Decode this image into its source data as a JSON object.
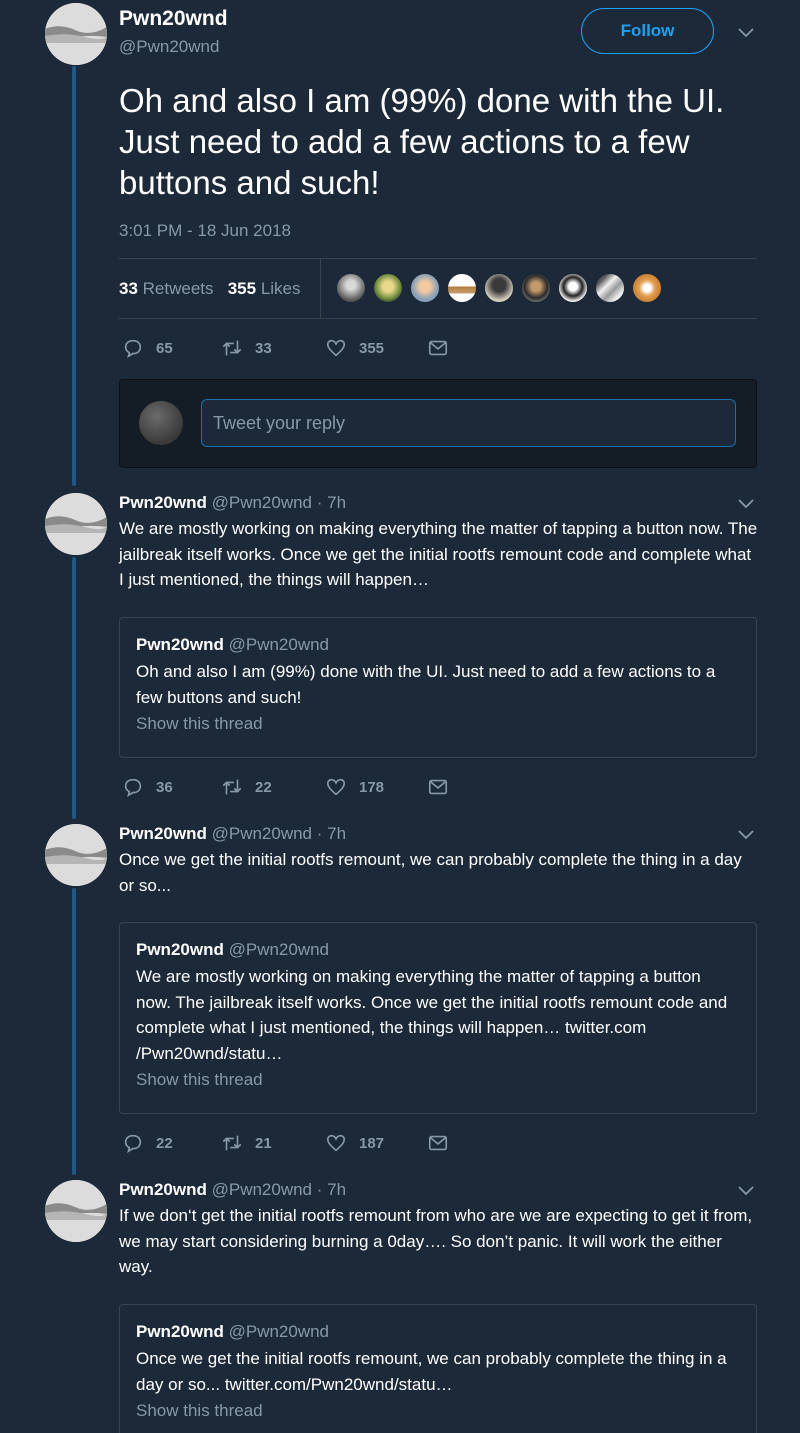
{
  "main_tweet": {
    "name": "Pwn20wnd",
    "handle": "@Pwn20wnd",
    "follow_label": "Follow",
    "text": "Oh and also I am (99%) done with the UI. Just need to add a few actions to a few buttons and such!",
    "timestamp": "3:01 PM - 18 Jun 2018",
    "retweets_count": "33",
    "retweets_label": "Retweets",
    "likes_count": "355",
    "likes_label": "Likes",
    "actions": {
      "replies": "65",
      "retweets": "33",
      "likes": "355"
    }
  },
  "reply_box": {
    "placeholder": "Tweet your reply"
  },
  "tweets": [
    {
      "name": "Pwn20wnd",
      "handle": "@Pwn20wnd",
      "time": "· 7h",
      "text": "We are mostly working on making everything the matter of tapping a button now. The jailbreak itself works. Once we get the initial rootfs remount code and complete what I just mentioned, the things will happen…",
      "quote": {
        "name": "Pwn20wnd",
        "handle": "@Pwn20wnd",
        "text": "Oh and also I am (99%) done with the UI. Just need to add a few actions to a few buttons and such!",
        "show_thread": "Show this thread"
      },
      "actions": {
        "replies": "36",
        "retweets": "22",
        "likes": "178"
      }
    },
    {
      "name": "Pwn20wnd",
      "handle": "@Pwn20wnd",
      "time": "· 7h",
      "text": "Once we get the initial rootfs remount, we can probably complete the thing in a day or so...",
      "quote": {
        "name": "Pwn20wnd",
        "handle": "@Pwn20wnd",
        "text": "We are mostly working on making everything the matter of tapping a button now. The jailbreak itself works. Once we get the initial rootfs remount code and complete what I just mentioned, the things will happen… twitter.com /Pwn20wnd/statu…",
        "show_thread": "Show this thread"
      },
      "actions": {
        "replies": "22",
        "retweets": "21",
        "likes": "187"
      }
    },
    {
      "name": "Pwn20wnd",
      "handle": "@Pwn20wnd",
      "time": "· 7h",
      "text": "If we don‘t get the initial rootfs remount from who are we are expecting to get it from, we may start considering burning a 0day…. So don’t panic. It will work the either way.",
      "quote": {
        "name": "Pwn20wnd",
        "handle": "@Pwn20wnd",
        "text": "Once we get the initial rootfs remount, we can probably complete the thing in a day or so... twitter.com/Pwn20wnd/statu…",
        "show_thread": "Show this thread"
      }
    }
  ],
  "colors": {
    "background": "#1c2938",
    "accent": "#1da1f2",
    "muted": "#8899a6",
    "thread_line": "#1b5a88"
  }
}
